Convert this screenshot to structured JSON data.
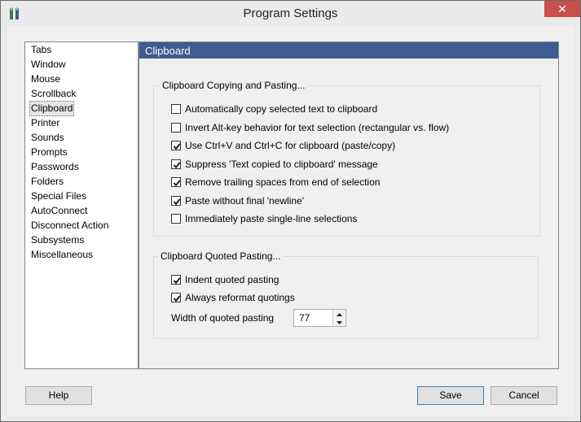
{
  "window": {
    "title": "Program Settings",
    "close_glyph": "✕"
  },
  "nav": {
    "items": [
      "Tabs",
      "Window",
      "Mouse",
      "Scrollback",
      "Clipboard",
      "Printer",
      "Sounds",
      "Prompts",
      "Passwords",
      "Folders",
      "Special Files",
      "AutoConnect",
      "Disconnect Action",
      "Subsystems",
      "Miscellaneous"
    ],
    "selected": "Clipboard"
  },
  "panel": {
    "header": "Clipboard",
    "copying_group": {
      "label": "Clipboard Copying and Pasting...",
      "options": [
        {
          "label": "Automatically copy selected text to clipboard",
          "checked": false
        },
        {
          "label": "Invert Alt-key behavior for text selection (rectangular vs. flow)",
          "checked": false
        },
        {
          "label": "Use Ctrl+V and Ctrl+C for clipboard (paste/copy)",
          "checked": true
        },
        {
          "label": "Suppress 'Text copied to clipboard' message",
          "checked": true
        },
        {
          "label": "Remove trailing spaces from end of selection",
          "checked": true
        },
        {
          "label": "Paste without final 'newline'",
          "checked": true
        },
        {
          "label": "Immediately paste single-line selections",
          "checked": false
        }
      ]
    },
    "quoted_group": {
      "label": "Clipboard Quoted Pasting...",
      "options": [
        {
          "label": "Indent quoted pasting",
          "checked": true
        },
        {
          "label": "Always reformat quotings",
          "checked": true
        }
      ],
      "width_label": "Width of quoted pasting",
      "width_value": "77"
    }
  },
  "buttons": {
    "help": "Help",
    "save": "Save",
    "cancel": "Cancel"
  },
  "icons": {
    "app": "app-tools-icon",
    "close": "close-icon",
    "check": "checkmark-icon",
    "spin_up": "spin-up-icon",
    "spin_down": "spin-down-icon"
  },
  "colors": {
    "header_bg": "#3f5b8f",
    "close_bg": "#c7504b",
    "default_button_border": "#3c7fb1"
  }
}
